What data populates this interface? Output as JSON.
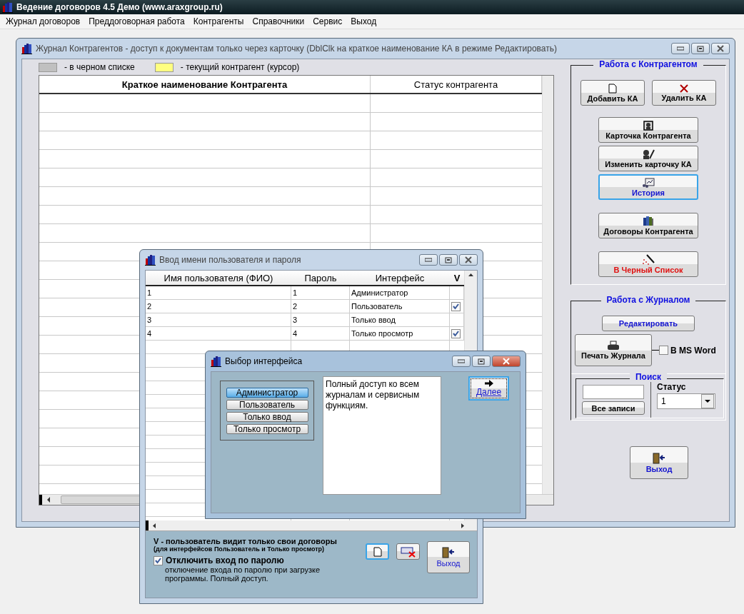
{
  "window": {
    "title": "Ведение договоров 4.5 Демо (www.araxgroup.ru)"
  },
  "menu": [
    "Журнал договоров",
    "Преддоговорная работа",
    "Контрагенты",
    "Справочники",
    "Сервис",
    "Выход"
  ],
  "journal_window": {
    "title": "Журнал Контрагентов - доступ к документам только через карточку (DblClk на краткое наименование КА в режиме Редактировать)",
    "active": false,
    "legend": [
      {
        "label": "- в черном списке",
        "color": "#c0c0c0"
      },
      {
        "label": "- текущий контрагент (курсор)",
        "color": "#ffff80"
      }
    ],
    "table": {
      "columns": [
        "Краткое наименование Контрагента",
        "Статус контрагента"
      ]
    },
    "counterparty_panel": {
      "title": "Работа с Контрагентом",
      "buttons": [
        {
          "label": "Добавить КА",
          "kind": "normal"
        },
        {
          "label": "Удалить КА",
          "kind": "normal"
        },
        {
          "label": "Карточка Контрагента",
          "kind": "normal"
        },
        {
          "label": "Изменить карточку КА",
          "kind": "normal"
        },
        {
          "label": "История",
          "kind": "highlight"
        },
        {
          "label": "Договоры Контрагента",
          "kind": "normal"
        },
        {
          "label": "В Черный Список",
          "kind": "warning"
        }
      ]
    },
    "journal_panel": {
      "title": "Работа с Журналом",
      "edit_button": "Редактировать",
      "print_button": "Печать Журнала",
      "ms_word": {
        "label": "В MS Word",
        "checked": false
      },
      "search": {
        "title": "Поиск",
        "all_button": "Все записи",
        "status_label": "Статус",
        "status_value": "1"
      }
    },
    "exit_button": "Выход"
  },
  "login_window": {
    "title": "Ввод имени пользователя и пароля",
    "active": false,
    "columns": [
      "Имя пользователя (ФИО)",
      "Пароль",
      "Интерфейс",
      "V"
    ],
    "rows": [
      {
        "name": "1",
        "password": "1",
        "interface": "Администратор",
        "own_only": false
      },
      {
        "name": "2",
        "password": "2",
        "interface": "Пользователь",
        "own_only": true
      },
      {
        "name": "3",
        "password": "3",
        "interface": "Только ввод",
        "own_only": false
      },
      {
        "name": "4",
        "password": "4",
        "interface": "Только просмотр",
        "own_only": true
      }
    ],
    "note": "V - пользователь видит только свои договоры",
    "note_sub": "(для интерфейсов Пользователь и Только просмотр)",
    "disable_login": {
      "label": "Отключить вход по паролю",
      "checked": true,
      "description": "отключение входа по паролю при загрузке программы. Полный доступ."
    },
    "exit_button": "Выход"
  },
  "interface_window": {
    "title": "Выбор интерфейса",
    "active": true,
    "options": [
      {
        "label": "Администратор",
        "selected": true
      },
      {
        "label": "Пользователь",
        "selected": false
      },
      {
        "label": "Только ввод",
        "selected": false
      },
      {
        "label": "Только просмотр",
        "selected": false
      }
    ],
    "description": "Полный доступ ко всем журналам и сервисным функциям.",
    "next_button": "Далее"
  }
}
